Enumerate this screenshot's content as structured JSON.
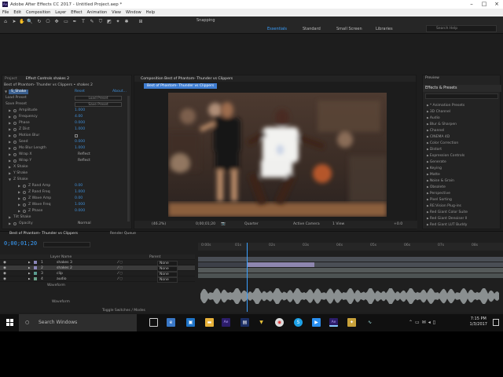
{
  "window": {
    "title": "Adobe After Effects CC 2017 - Untitled Project.aep *",
    "app_badge": "Ae"
  },
  "menu": [
    "File",
    "Edit",
    "Composition",
    "Layer",
    "Effect",
    "Animation",
    "View",
    "Window",
    "Help"
  ],
  "toolbar": {
    "snapping": "Snapping",
    "workspaces": [
      "Essentials",
      "Standard",
      "Small Screen",
      "Libraries"
    ],
    "search_placeholder": "Search Help"
  },
  "left_panel": {
    "tabs": [
      "Project",
      "Effect Controls shakes 2"
    ],
    "breadcrumb": "Best of Phantom- Thunder vs Clippers • shakes 2",
    "effect_name": "S_Shake",
    "effect_reset": "Reset",
    "effect_about": "About...",
    "rows": [
      {
        "label": "Load Preset",
        "button": "Load Preset"
      },
      {
        "label": "Save Preset",
        "button": "Save Preset"
      },
      {
        "label": "Amplitude",
        "value": "1.000"
      },
      {
        "label": "Frequency",
        "value": "4.00"
      },
      {
        "label": "Phase",
        "value": "0.000"
      },
      {
        "label": "Z Dist",
        "value": "1.000"
      },
      {
        "label": "Motion Blur",
        "value": ""
      },
      {
        "label": "Seed",
        "value": "0.000"
      },
      {
        "label": "Mo Blur Length",
        "value": "1.000"
      },
      {
        "label": "Wrap X",
        "value": "Reflect"
      },
      {
        "label": "Wrap Y",
        "value": "Reflect"
      },
      {
        "label": "X Shake",
        "value": ""
      },
      {
        "label": "Y Shake",
        "value": ""
      },
      {
        "label": "Z Shake",
        "value": ""
      },
      {
        "label": "Z Rand Amp",
        "value": "0.00"
      },
      {
        "label": "Z Rand Freq",
        "value": "1.000"
      },
      {
        "label": "Z Wave Amp",
        "value": "0.00"
      },
      {
        "label": "Z Wave Freq",
        "value": "1.000"
      },
      {
        "label": "Z Phase",
        "value": "0.000"
      },
      {
        "label": "Tilt Shake",
        "value": ""
      },
      {
        "label": "Opacity",
        "value": "Normal"
      }
    ]
  },
  "composition": {
    "tab": "Composition Best of Phantom- Thunder vs Clippers",
    "subtab": "Best of Phantom- Thunder vs Clippers",
    "controls": {
      "zoom": "(46.2%)",
      "timecode": "0;00;01;20",
      "resolution": "Quarter",
      "camera": "Active Camera",
      "views": "1 View",
      "exposure": "+0.0"
    }
  },
  "right_panel": {
    "preview_tab": "Preview",
    "effects_tab": "Effects & Presets",
    "items": [
      "* Animation Presets",
      "3D Channel",
      "Audio",
      "Blur & Sharpen",
      "Channel",
      "CINEMA 4D",
      "Color Correction",
      "Distort",
      "Expression Controls",
      "Generate",
      "Keying",
      "Matte",
      "Noise & Grain",
      "Obsolete",
      "Perspective",
      "Pixel Sorting",
      "RE:Vision Plug-ins",
      "Red Giant Color Suite",
      "Red Giant Denoiser II",
      "Red Giant LUT Buddy"
    ]
  },
  "timeline": {
    "tabs": [
      "Best of Phantom- Thunder vs Clippers",
      "Render Queue"
    ],
    "timecode": "0;00;01;20",
    "col_layer": "Layer Name",
    "col_parent": "Parent",
    "layers": [
      {
        "num": "1",
        "name": "shakes 3",
        "parent": "None"
      },
      {
        "num": "2",
        "name": "shakes 2",
        "parent": "None"
      },
      {
        "num": "3",
        "name": "clip",
        "parent": "None"
      },
      {
        "num": "4",
        "name": "audio",
        "parent": "None"
      }
    ],
    "sublabel": "Waveform",
    "sublabel2": "Waveform",
    "ruler": [
      "0:00s",
      "01s",
      "02s",
      "03s",
      "04s",
      "05s",
      "06s",
      "07s",
      "08s",
      "09s"
    ],
    "toggle": "Toggle Switches / Modes"
  },
  "taskbar": {
    "search": "Search Windows",
    "time": "7:15 PM",
    "date": "1/3/2017"
  },
  "colors": {
    "accent": "#3aa0ff",
    "selected": "#3a5f8f"
  }
}
